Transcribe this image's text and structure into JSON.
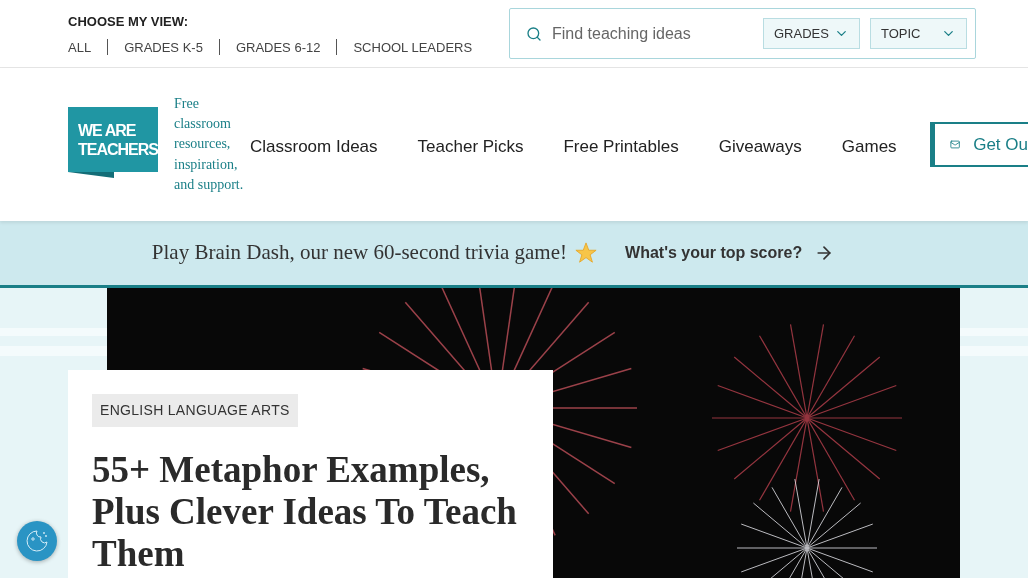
{
  "view_switcher": {
    "label": "CHOOSE MY VIEW:",
    "options": [
      {
        "label": "ALL",
        "selected": false
      },
      {
        "label": "GRADES K-5",
        "selected": false
      },
      {
        "label": "GRADES 6-12",
        "selected": false
      },
      {
        "label": "SCHOOL LEADERS",
        "selected": false
      }
    ]
  },
  "search": {
    "placeholder": "Find teaching ideas",
    "filters": [
      "GRADES",
      "TOPIC"
    ]
  },
  "logo": {
    "lines": [
      "WE ARE",
      "TEACHERS"
    ]
  },
  "tagline": "Free classroom resources, inspiration, and support.",
  "nav": [
    "Classroom Ideas",
    "Teacher Picks",
    "Free Printables",
    "Giveaways",
    "Games"
  ],
  "cta": "Get Ou",
  "banner": {
    "text": "Play Brain Dash, our new 60-second trivia game!",
    "link": "What's your top score?"
  },
  "article": {
    "category": "ENGLISH LANGUAGE ARTS",
    "title": "55+ Metaphor Examples, Plus Clever Ideas To Teach Them"
  }
}
